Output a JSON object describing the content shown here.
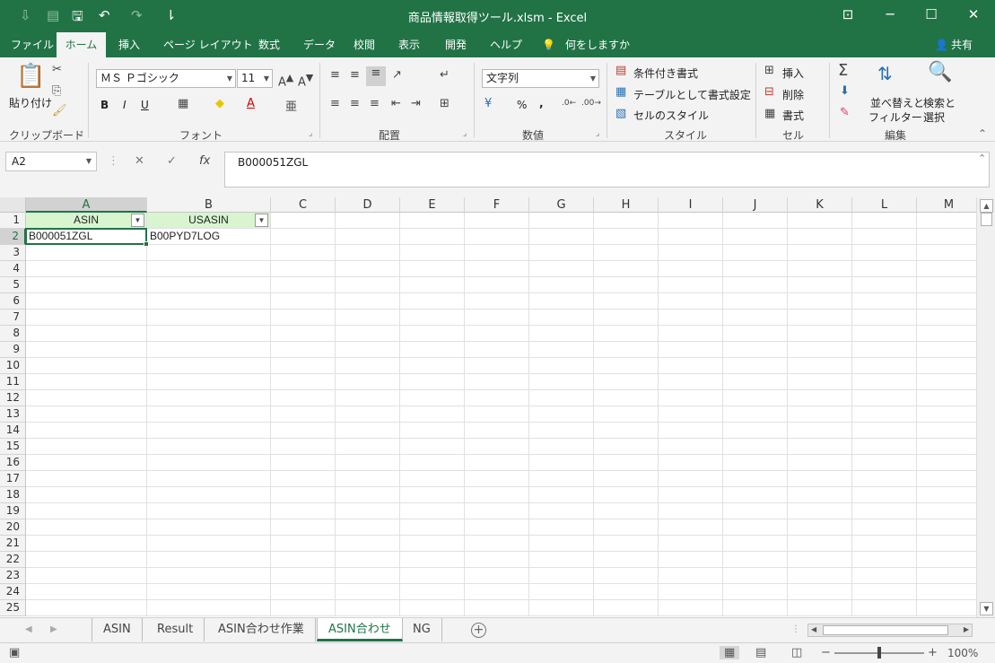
{
  "window": {
    "title": "商品情報取得ツール.xlsm  -  Excel",
    "minimize": "─",
    "restore": "☐",
    "close": "✕",
    "ribbon_display": "⊡"
  },
  "quick_access": {
    "autosave": "⇩",
    "touch": "▤",
    "save": "🖫",
    "undo": "↶",
    "redo": "↷",
    "customize": "⇂"
  },
  "ribbon_tabs": [
    "ファイル",
    "ホーム",
    "挿入",
    "ページ レイアウト",
    "数式",
    "データ",
    "校閲",
    "表示",
    "開発",
    "ヘルプ",
    "何をしますか"
  ],
  "active_tab": "ホーム",
  "share": "共有",
  "ribbon": {
    "clipboard": {
      "label": "クリップボード",
      "paste": "貼り付け"
    },
    "font": {
      "label": "フォント",
      "font_name": "ＭＳ Ｐゴシック",
      "font_size": "11",
      "bold": "B",
      "italic": "I",
      "underline": "U"
    },
    "alignment": {
      "label": "配置"
    },
    "number": {
      "label": "数値",
      "format": "文字列",
      "percent": "%",
      "comma": ","
    },
    "styles": {
      "label": "スタイル",
      "conditional": "条件付き書式",
      "table": "テーブルとして書式設定",
      "cell_styles": "セルのスタイル"
    },
    "cells": {
      "label": "セル",
      "insert": "挿入",
      "delete": "削除",
      "format": "書式"
    },
    "editing": {
      "label": "編集",
      "sort_filter_1": "並べ替えと",
      "sort_filter_2": "フィルター",
      "find_1": "検索と",
      "find_2": "選択"
    }
  },
  "formula_bar": {
    "name_box": "A2",
    "cancel": "✕",
    "enter": "✓",
    "fx": "fx",
    "formula": "B000051ZGL"
  },
  "columns": [
    "A",
    "B",
    "C",
    "D",
    "E",
    "F",
    "G",
    "H",
    "I",
    "J",
    "K",
    "L",
    "M"
  ],
  "rows": [
    "1",
    "2",
    "3",
    "4",
    "5",
    "6",
    "7",
    "8",
    "9",
    "10",
    "11",
    "12",
    "13",
    "14",
    "15",
    "16",
    "17",
    "18",
    "19",
    "20",
    "21",
    "22",
    "23",
    "24",
    "25"
  ],
  "cells": {
    "A1": "ASIN",
    "B1": "USASIN",
    "A2": "B000051ZGL",
    "B2": "B00PYD7LOG"
  },
  "sheet_tabs": [
    "ASIN",
    "Result",
    "ASIN合わせ作業",
    "ASIN合わせ",
    "NG"
  ],
  "active_sheet": "ASIN合わせ",
  "status": {
    "zoom": "100%",
    "zoom_minus": "−",
    "zoom_plus": "+"
  },
  "colors": {
    "accent": "#217346",
    "header_fill": "#d8f5d0"
  }
}
